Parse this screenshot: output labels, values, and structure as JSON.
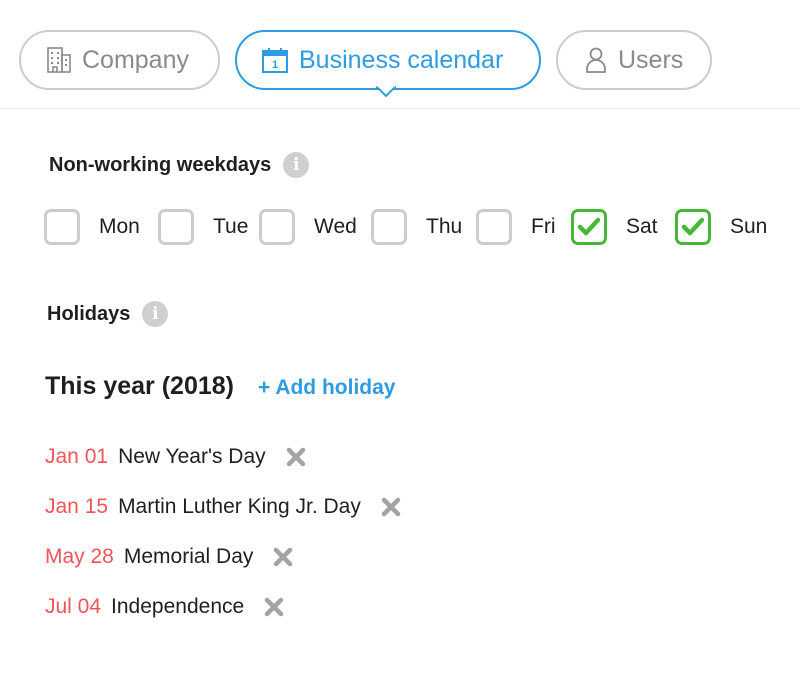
{
  "tabs": [
    {
      "label": "Company",
      "icon": "building-icon",
      "active": false
    },
    {
      "label": "Business calendar",
      "icon": "calendar-icon",
      "icon_text": "1",
      "active": true
    },
    {
      "label": "Users",
      "icon": "user-icon",
      "active": false
    }
  ],
  "weekdays_section": {
    "title": "Non-working weekdays",
    "info_icon": "i",
    "days": [
      {
        "label": "Mon",
        "checked": false
      },
      {
        "label": "Tue",
        "checked": false
      },
      {
        "label": "Wed",
        "checked": false
      },
      {
        "label": "Thu",
        "checked": false
      },
      {
        "label": "Fri",
        "checked": false
      },
      {
        "label": "Sat",
        "checked": true
      },
      {
        "label": "Sun",
        "checked": true
      }
    ]
  },
  "holidays_section": {
    "title": "Holidays",
    "info_icon": "i",
    "year_title": "This year (2018)",
    "add_label": "+ Add holiday",
    "items": [
      {
        "date": "Jan 01",
        "name": "New Year's Day"
      },
      {
        "date": "Jan 15",
        "name": "Martin Luther King Jr. Day"
      },
      {
        "date": "May 28",
        "name": "Memorial Day"
      },
      {
        "date": "Jul 04",
        "name": "Independence"
      }
    ]
  },
  "colors": {
    "accent": "#2e9be3",
    "checked": "#45b935",
    "date": "#f0555a",
    "muted": "#8a8a8a"
  }
}
